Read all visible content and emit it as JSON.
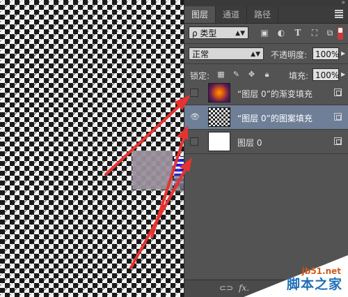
{
  "tabs": [
    {
      "label": "图层",
      "active": true
    },
    {
      "label": "通道",
      "active": false
    },
    {
      "label": "路径",
      "active": false
    }
  ],
  "filter": {
    "kind_label": "ρ 类型",
    "icons": [
      "image-filter-icon",
      "adjustment-filter-icon",
      "type-filter-icon",
      "shape-filter-icon",
      "smart-object-filter-icon"
    ]
  },
  "blend": {
    "mode": "正常",
    "opacity_label": "不透明度:",
    "opacity_value": "100%"
  },
  "lock": {
    "label": "锁定:",
    "fill_label": "填充:",
    "fill_value": "100%"
  },
  "layers": [
    {
      "name": "“图层 0”的渐变填充",
      "visible": false,
      "selected": false,
      "thumb": "gradient"
    },
    {
      "name": "“图层 0”的图案填充",
      "visible": true,
      "selected": true,
      "thumb": "pattern"
    },
    {
      "name": "图层 0",
      "visible": false,
      "selected": false,
      "thumb": "white"
    }
  ],
  "bottom_icons": [
    "link-icon",
    "fx-icon"
  ],
  "bottom": {
    "fx_label": "fx."
  },
  "watermark": {
    "site": "jb51.net",
    "text": "脚本之家"
  },
  "colors": {
    "panel_bg": "#535353",
    "selected_layer": "#6e7f97",
    "annotation_arrow": "#e8322f"
  }
}
